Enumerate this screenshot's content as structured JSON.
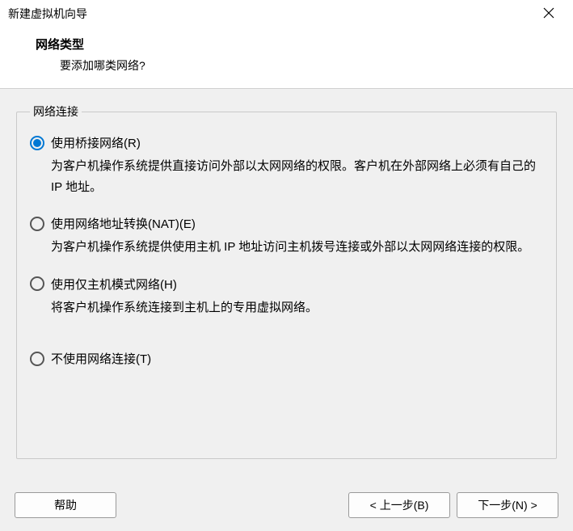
{
  "window": {
    "title": "新建虚拟机向导"
  },
  "header": {
    "heading": "网络类型",
    "sub": "要添加哪类网络?"
  },
  "group": {
    "legend": "网络连接",
    "options": [
      {
        "label": "使用桥接网络(R)",
        "desc": "为客户机操作系统提供直接访问外部以太网网络的权限。客户机在外部网络上必须有自己的 IP 地址。",
        "selected": true
      },
      {
        "label": "使用网络地址转换(NAT)(E)",
        "desc": "为客户机操作系统提供使用主机 IP 地址访问主机拨号连接或外部以太网网络连接的权限。",
        "selected": false
      },
      {
        "label": "使用仅主机模式网络(H)",
        "desc": "将客户机操作系统连接到主机上的专用虚拟网络。",
        "selected": false
      },
      {
        "label": "不使用网络连接(T)",
        "desc": "",
        "selected": false
      }
    ]
  },
  "footer": {
    "help": "帮助",
    "back": "< 上一步(B)",
    "next": "下一步(N) >"
  }
}
